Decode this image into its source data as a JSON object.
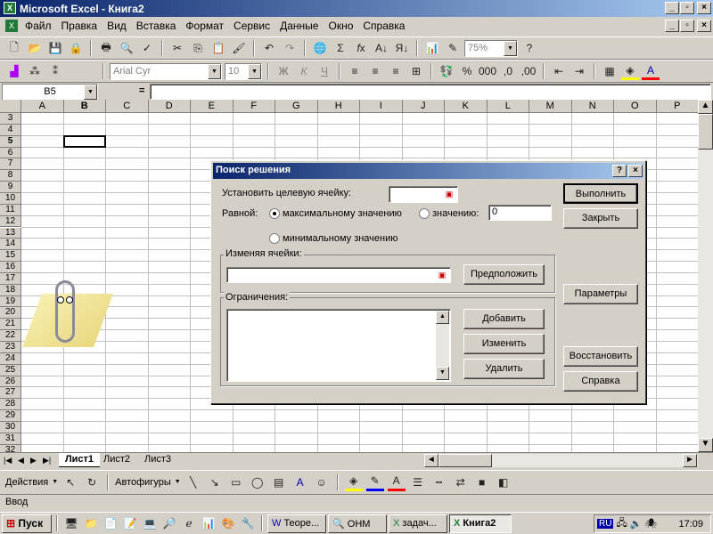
{
  "window": {
    "title": "Microsoft Excel - Книга2"
  },
  "menu": [
    "Файл",
    "Правка",
    "Вид",
    "Вставка",
    "Формат",
    "Сервис",
    "Данные",
    "Окно",
    "Справка"
  ],
  "toolbar": {
    "zoom": "75%",
    "font": "Arial Cyr",
    "size": "10"
  },
  "formula": {
    "cell": "B5",
    "eq": "="
  },
  "columns": [
    "A",
    "B",
    "C",
    "D",
    "E",
    "F",
    "G",
    "H",
    "I",
    "J",
    "K",
    "L",
    "M",
    "N",
    "O",
    "P"
  ],
  "rows": [
    "3",
    "4",
    "5",
    "6",
    "7",
    "8",
    "9",
    "10",
    "11",
    "12",
    "13",
    "14",
    "15",
    "16",
    "17",
    "18",
    "19",
    "20",
    "21",
    "22",
    "23",
    "24",
    "25",
    "26",
    "27",
    "28",
    "29",
    "30",
    "31",
    "32"
  ],
  "dialog": {
    "title": "Поиск решения",
    "target_label": "Установить целевую ячейку:",
    "equal_label": "Равной:",
    "opt_max": "максимальному значению",
    "opt_value": "значению:",
    "value": "0",
    "opt_min": "минимальному значению",
    "changing_label": "Изменяя ячейки:",
    "constraints_label": "Ограничения:",
    "btn_solve": "Выполнить",
    "btn_close": "Закрыть",
    "btn_guess": "Предположить",
    "btn_options": "Параметры",
    "btn_add": "Добавить",
    "btn_change": "Изменить",
    "btn_delete": "Удалить",
    "btn_reset": "Восстановить",
    "btn_help": "Справка"
  },
  "sheets": [
    "Лист1",
    "Лист2",
    "Лист3"
  ],
  "drawing": {
    "actions": "Действия",
    "autoshapes": "Автофигуры"
  },
  "status": "Ввод",
  "taskbar": {
    "start": "Пуск",
    "tasks": [
      "Теоре...",
      "ОНМ",
      "задач...",
      "Книга2"
    ],
    "lang": "RU",
    "clock": "17:09"
  }
}
